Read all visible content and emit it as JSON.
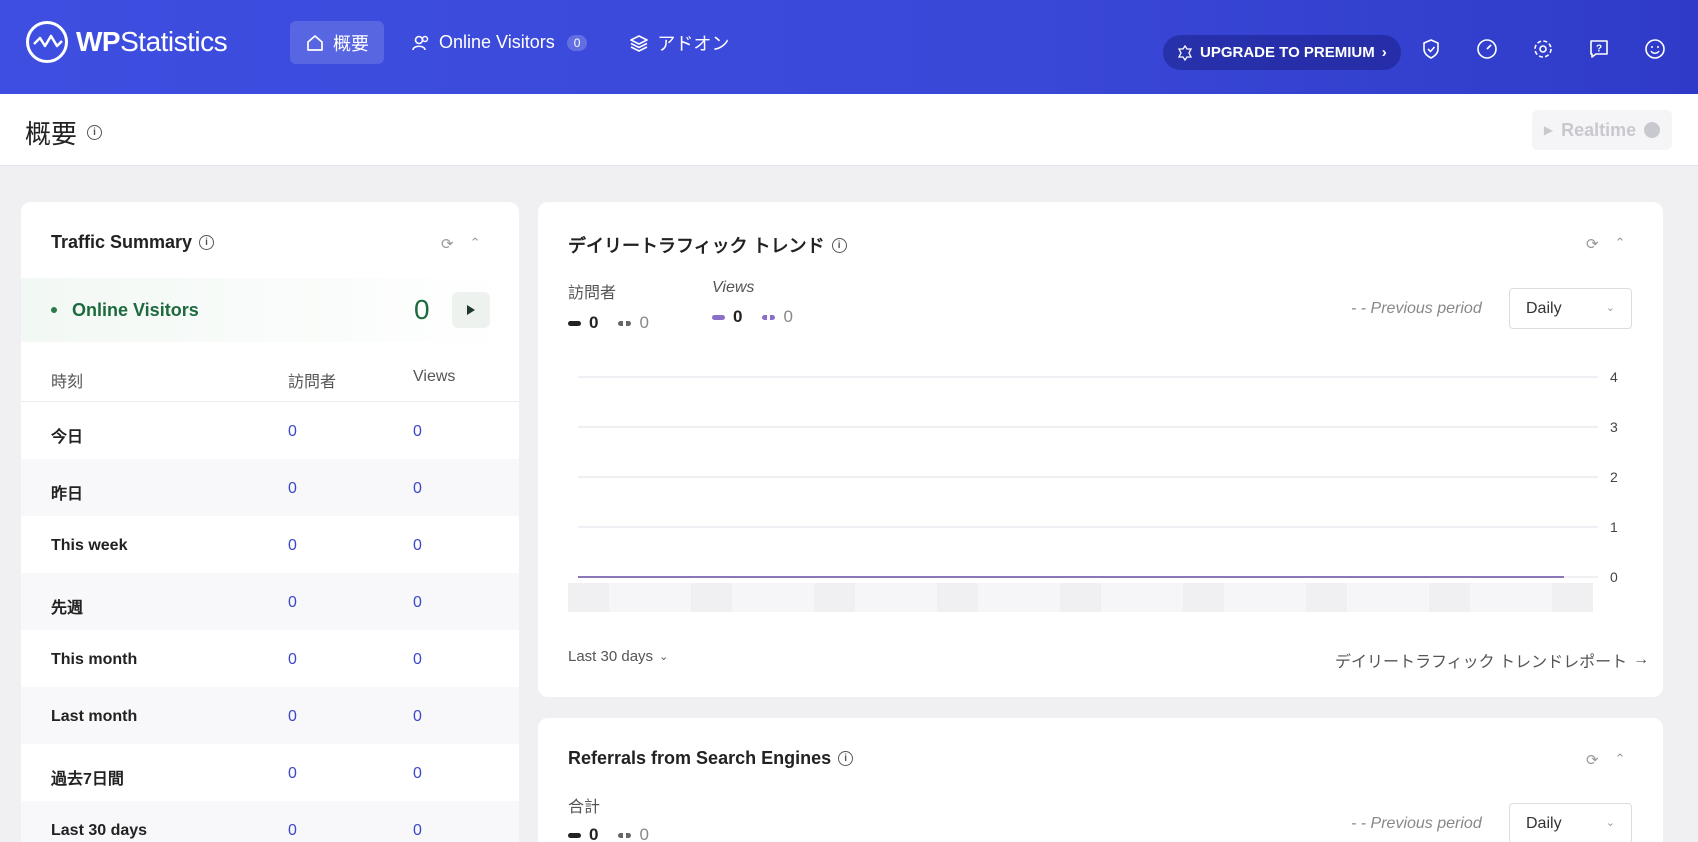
{
  "brand": {
    "name_bold": "WP",
    "name_rest": "Statistics"
  },
  "nav": {
    "overview": "概要",
    "online_visitors": "Online Visitors",
    "online_badge": "0",
    "addons": "アドオン"
  },
  "upgrade": "UPGRADE TO PREMIUM",
  "page": {
    "title": "概要",
    "realtime": "Realtime"
  },
  "traffic_summary": {
    "title": "Traffic Summary",
    "online_label": "Online Visitors",
    "online_count": "0",
    "columns": [
      "時刻",
      "訪問者",
      "Views"
    ],
    "rows": [
      {
        "label": "今日",
        "visitors": "0",
        "views": "0"
      },
      {
        "label": "昨日",
        "visitors": "0",
        "views": "0"
      },
      {
        "label": "This week",
        "visitors": "0",
        "views": "0"
      },
      {
        "label": "先週",
        "visitors": "0",
        "views": "0"
      },
      {
        "label": "This month",
        "visitors": "0",
        "views": "0"
      },
      {
        "label": "Last month",
        "visitors": "0",
        "views": "0"
      },
      {
        "label": "過去7日間",
        "visitors": "0",
        "views": "0"
      },
      {
        "label": "Last 30 days",
        "visitors": "0",
        "views": "0"
      }
    ]
  },
  "daily_trend": {
    "title": "デイリートラフィック トレンド",
    "visitors_label": "訪問者",
    "visitors_value": "0",
    "visitors_prev": "0",
    "views_label": "Views",
    "views_value": "0",
    "views_prev": "0",
    "previous_period": "Previous period",
    "period_select": "Daily",
    "range": "Last 30 days",
    "report_link": "デイリートラフィック トレンドレポート",
    "colors": {
      "visitors": "#222222",
      "views": "#8a6fc8",
      "prev": "#888888"
    }
  },
  "chart_data": {
    "type": "line",
    "y_ticks": [
      "4",
      "3",
      "2",
      "1",
      "0"
    ],
    "ylim": [
      0,
      4
    ],
    "series": [
      {
        "name": "訪問者",
        "values": [
          0,
          0,
          0,
          0,
          0,
          0,
          0,
          0,
          0,
          0,
          0,
          0,
          0,
          0,
          0,
          0,
          0,
          0,
          0,
          0,
          0,
          0,
          0,
          0,
          0,
          0,
          0,
          0,
          0,
          0
        ]
      },
      {
        "name": "Views",
        "values": [
          0,
          0,
          0,
          0,
          0,
          0,
          0,
          0,
          0,
          0,
          0,
          0,
          0,
          0,
          0,
          0,
          0,
          0,
          0,
          0,
          0,
          0,
          0,
          0,
          0,
          0,
          0,
          0,
          0,
          0
        ]
      }
    ],
    "grid": true
  },
  "referrals": {
    "title": "Referrals from Search Engines",
    "total_label": "合計",
    "total_value": "0",
    "total_prev": "0",
    "previous_period": "Previous period",
    "period_select": "Daily"
  }
}
